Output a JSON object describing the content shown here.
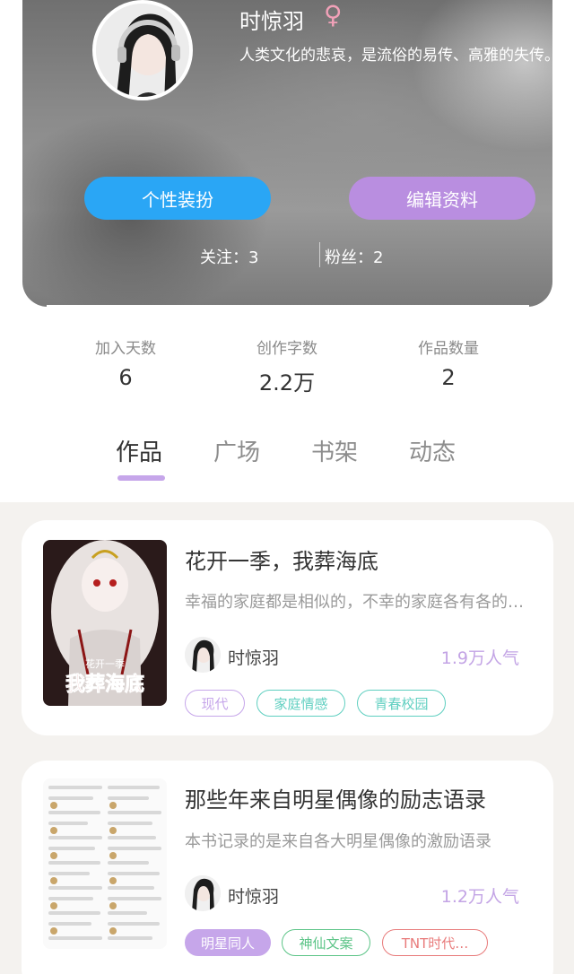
{
  "profile": {
    "name": "时惊羽",
    "gender_icon": "female-icon",
    "bio": "人类文化的悲哀，是流俗的易传、高雅的失传。",
    "buttons": {
      "dress_up": "个性装扮",
      "edit_profile": "编辑资料"
    },
    "following": "关注：3",
    "followers": "粉丝：2",
    "colors": {
      "dress_button": "#2aa6f5",
      "edit_button": "#b98ee0"
    }
  },
  "stats": [
    {
      "label": "加入天数",
      "value": "6"
    },
    {
      "label": "创作字数",
      "value": "2.2万"
    },
    {
      "label": "作品数量",
      "value": "2"
    }
  ],
  "tabs": [
    {
      "label": "作品",
      "active": true
    },
    {
      "label": "广场",
      "active": false
    },
    {
      "label": "书架",
      "active": false
    },
    {
      "label": "动态",
      "active": false
    }
  ],
  "books": [
    {
      "title": "花开一季，我葬海底",
      "description": "幸福的家庭都是相似的，不幸的家庭各有各的不幸",
      "author": "时惊羽",
      "popularity": "1.9万人气",
      "cover_text": "我葬海底",
      "cover_subtitle": "花开一季",
      "tags": [
        {
          "label": "现代",
          "color": "#c6a6ea"
        },
        {
          "label": "家庭情感",
          "color": "#5fcfc0"
        },
        {
          "label": "青春校园",
          "color": "#5fcfc0"
        }
      ]
    },
    {
      "title": "那些年来自明星偶像的励志语录",
      "description": "本书记录的是来自各大明星偶像的激励语录",
      "author": "时惊羽",
      "popularity": "1.2万人气",
      "tags": [
        {
          "label": "明星同人",
          "color": "#c6a6ea"
        },
        {
          "label": "神仙文案",
          "color": "#5cc487"
        },
        {
          "label": "TNT时代…",
          "color": "#e87a7a"
        }
      ]
    }
  ]
}
